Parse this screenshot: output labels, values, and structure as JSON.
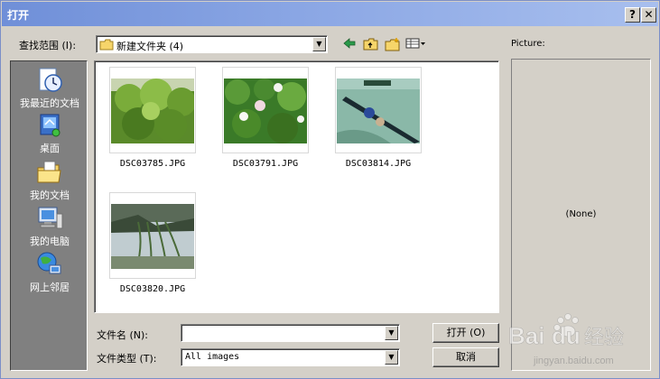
{
  "window": {
    "title": "打开",
    "help_label": "?",
    "close_label": "✕"
  },
  "lookin": {
    "label": "查找范围 (I):",
    "value": "新建文件夹 (4)"
  },
  "toolbar": {
    "icons": [
      "back-arrow-icon",
      "up-folder-icon",
      "new-folder-icon",
      "view-menu-icon"
    ]
  },
  "places": [
    {
      "label": "我最近的文档",
      "icon": "recent-documents-icon"
    },
    {
      "label": "桌面",
      "icon": "desktop-icon"
    },
    {
      "label": "我的文档",
      "icon": "my-documents-icon"
    },
    {
      "label": "我的电脑",
      "icon": "my-computer-icon"
    },
    {
      "label": "网上邻居",
      "icon": "network-places-icon"
    }
  ],
  "files": [
    {
      "name": "DSC03785.JPG"
    },
    {
      "name": "DSC03791.JPG"
    },
    {
      "name": "DSC03814.JPG"
    },
    {
      "name": "DSC03820.JPG"
    }
  ],
  "filename": {
    "label": "文件名 (N):",
    "value": ""
  },
  "filetype": {
    "label": "文件类型 (T):",
    "value": "All images"
  },
  "buttons": {
    "open": "打开 (O)",
    "cancel": "取消"
  },
  "preview": {
    "label": "Picture:",
    "value": "(None)"
  },
  "watermark": {
    "brand": "Bai",
    "brand2": "du",
    "suffix": "经验",
    "url": "jingyan.baidu.com"
  }
}
